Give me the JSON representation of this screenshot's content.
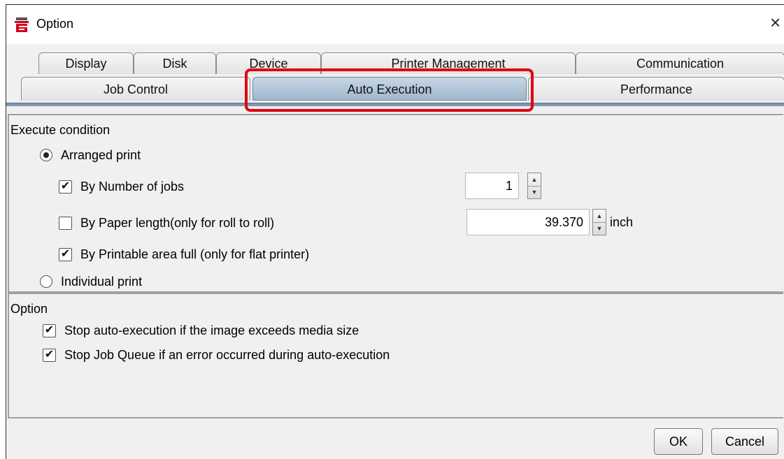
{
  "window": {
    "title": "Option",
    "close_glyph": "×",
    "icon": "app-logo-icon",
    "accent_color": "#e3000f"
  },
  "tabs": {
    "row1": [
      {
        "label": "Display"
      },
      {
        "label": "Disk"
      },
      {
        "label": "Device"
      },
      {
        "label": "Printer Management"
      },
      {
        "label": "Communication"
      }
    ],
    "row2": [
      {
        "label": "Job Control"
      },
      {
        "label": "Auto Execution",
        "selected": true
      },
      {
        "label": "Performance"
      }
    ]
  },
  "execute_condition": {
    "title": "Execute condition",
    "arranged_print": {
      "label": "Arranged print",
      "selected": true
    },
    "by_number_of_jobs": {
      "label": "By Number of jobs",
      "checked": true,
      "value": "1"
    },
    "by_paper_length": {
      "label": "By Paper length(only for roll to roll)",
      "checked": false,
      "value": "39.370",
      "unit": "inch"
    },
    "by_printable_area": {
      "label": "By Printable area full (only for flat printer)",
      "checked": true
    },
    "individual_print": {
      "label": "Individual print",
      "selected": false
    }
  },
  "option_group": {
    "title": "Option",
    "stop_auto_execution": {
      "label": "Stop auto-execution if the image exceeds media size",
      "checked": true
    },
    "stop_job_queue": {
      "label": "Stop Job Queue if an error occurred during auto-execution",
      "checked": true
    }
  },
  "footer": {
    "ok_label": "OK",
    "cancel_label": "Cancel"
  },
  "glyphs": {
    "check": "✔",
    "spin_up": "▲",
    "spin_down": "▼"
  }
}
